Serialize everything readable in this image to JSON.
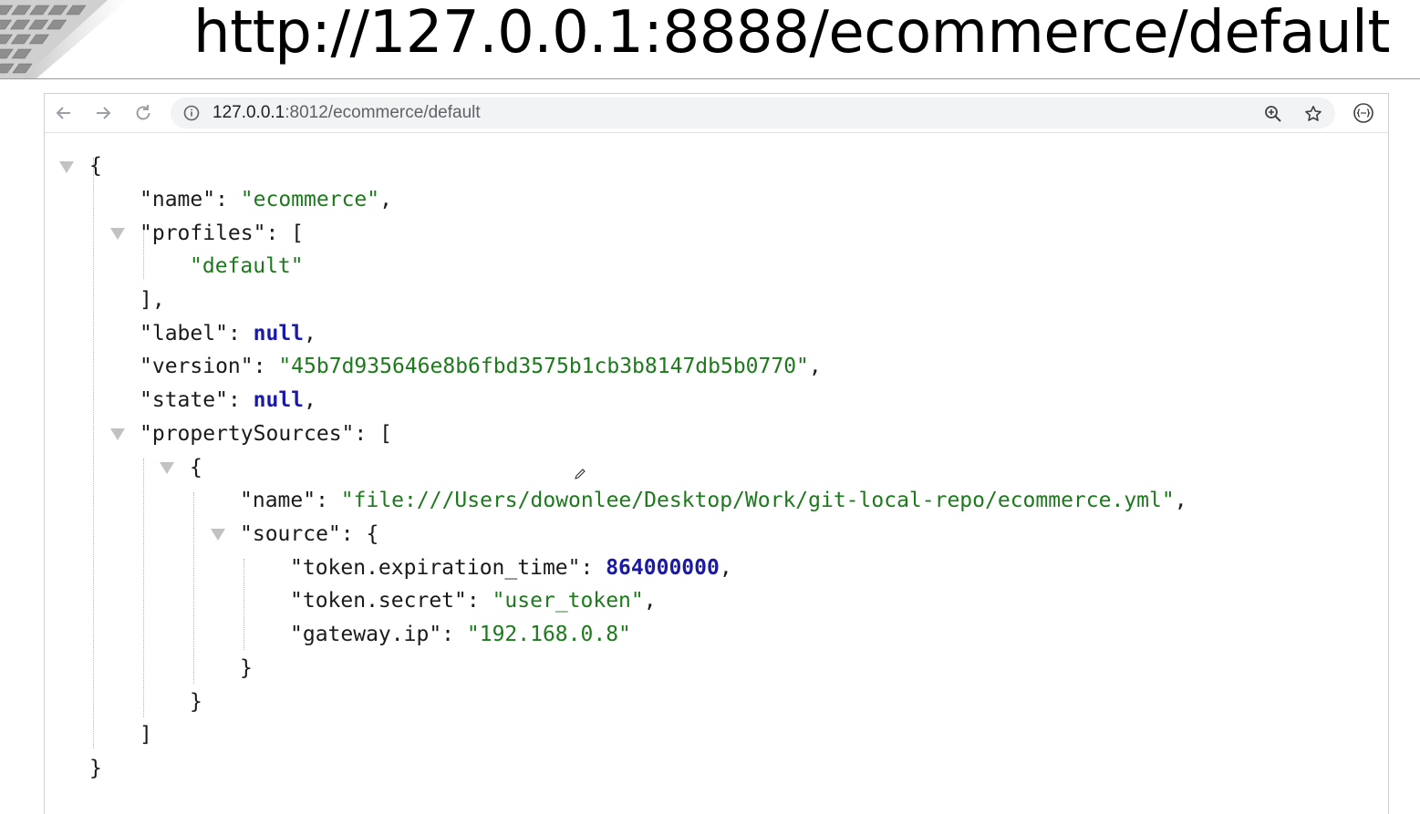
{
  "banner": {
    "title": "http://127.0.0.1:8888/ecommerce/default"
  },
  "browser": {
    "address": {
      "host": "127.0.0.1",
      "path": ":8012/ecommerce/default"
    },
    "icons": [
      "back-arrow-icon",
      "forward-arrow-icon",
      "reload-icon",
      "info-icon",
      "zoom-icon",
      "star-icon",
      "extension-icon"
    ]
  },
  "json": {
    "open_root": "{",
    "name_key": "\"name\"",
    "name_value": "\"ecommerce\"",
    "profiles_key": "\"profiles\"",
    "profiles_item": "\"default\"",
    "profiles_close": "],",
    "label_key": "\"label\"",
    "label_value": "null",
    "version_key": "\"version\"",
    "version_value": "\"45b7d935646e8b6fbd3575b1cb3b8147db5b0770\"",
    "state_key": "\"state\"",
    "state_value": "null",
    "propertySources_key": "\"propertySources\"",
    "ps_open": "{",
    "ps_name_key": "\"name\"",
    "ps_name_value": "\"file:///Users/dowonlee/Desktop/Work/git-local-repo/ecommerce.yml\"",
    "source_key": "\"source\"",
    "token_exp_key": "\"token.expiration_time\"",
    "token_exp_value": "864000000",
    "token_secret_key": "\"token.secret\"",
    "token_secret_value": "\"user_token\"",
    "gateway_key": "\"gateway.ip\"",
    "gateway_value": "\"192.168.0.8\"",
    "source_close": "}",
    "ps_close": "}",
    "array_close": "]",
    "close_root": "}"
  },
  "colors": {
    "string": "#1c7a1c",
    "literal": "#1a1aa6",
    "text": "#1a1a1a"
  }
}
